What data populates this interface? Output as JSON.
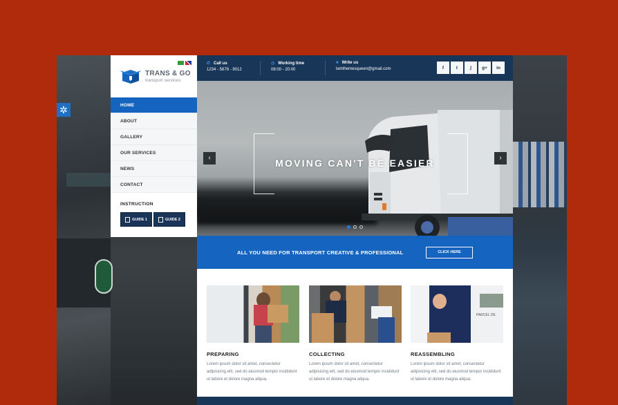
{
  "brand": {
    "name": "TRANS & GO",
    "tagline": "transport services",
    "primary_color": "#1565c0",
    "dark_color": "#183658",
    "page_background": "#b02a0c"
  },
  "languages": [
    "pt-BR",
    "en-GB"
  ],
  "settings": {
    "icon": "gear-icon",
    "glyph": "✲"
  },
  "nav": {
    "items": [
      {
        "label": "HOME",
        "active": true
      },
      {
        "label": "ABOUT",
        "active": false
      },
      {
        "label": "GALLERY",
        "active": false
      },
      {
        "label": "OUR SERVICES",
        "active": false
      },
      {
        "label": "NEWS",
        "active": false
      },
      {
        "label": "CONTACT",
        "active": false
      }
    ]
  },
  "instruction": {
    "heading": "INSTRUCTION",
    "guides": [
      "GUIDE 1",
      "GUIDE 2"
    ]
  },
  "topbar": {
    "call": {
      "title": "Call us",
      "value": "1234 - 5678 - 9012"
    },
    "hours": {
      "title": "Working time",
      "value": "08:00 - 20:00"
    },
    "email": {
      "title": "Write us",
      "value": "lamthemesqueen@gmail.com"
    },
    "socials": [
      {
        "name": "facebook",
        "glyph": "f"
      },
      {
        "name": "twitter",
        "glyph": "t"
      },
      {
        "name": "rss",
        "glyph": "ʃ"
      },
      {
        "name": "google-plus",
        "glyph": "g+"
      },
      {
        "name": "linkedin",
        "glyph": "in"
      }
    ]
  },
  "hero": {
    "title": "MOVING CAN'T BE EASIER",
    "prev": "‹",
    "next": "›",
    "slides": 3,
    "active_slide": 1
  },
  "cta": {
    "text": "ALL YOU NEED FOR TRANSPORT CREATIVE & PROFESSIONAL",
    "button": "CLICK HERE"
  },
  "services": [
    {
      "title": "PREPARING",
      "text": "Lorem ipsum dolor sit amet, consectetur adipisicing elit, sed do eiusmod tempor incididunt ut labore et dolore magna aliqua."
    },
    {
      "title": "COLLECTING",
      "text": "Lorem ipsum dolor sit amet, consectetur adipisicing elit, sed do eiusmod tempor incididunt ut labore et dolore magna aliqua."
    },
    {
      "title": "REASSEMBLING",
      "text": "Lorem ipsum dolor sit amet, consectetur adipisicing elit, sed do eiusmod tempor incididunt ut labore et dolore magna aliqua."
    }
  ],
  "images": {
    "card_3_van_text": "PARCEL DE"
  }
}
